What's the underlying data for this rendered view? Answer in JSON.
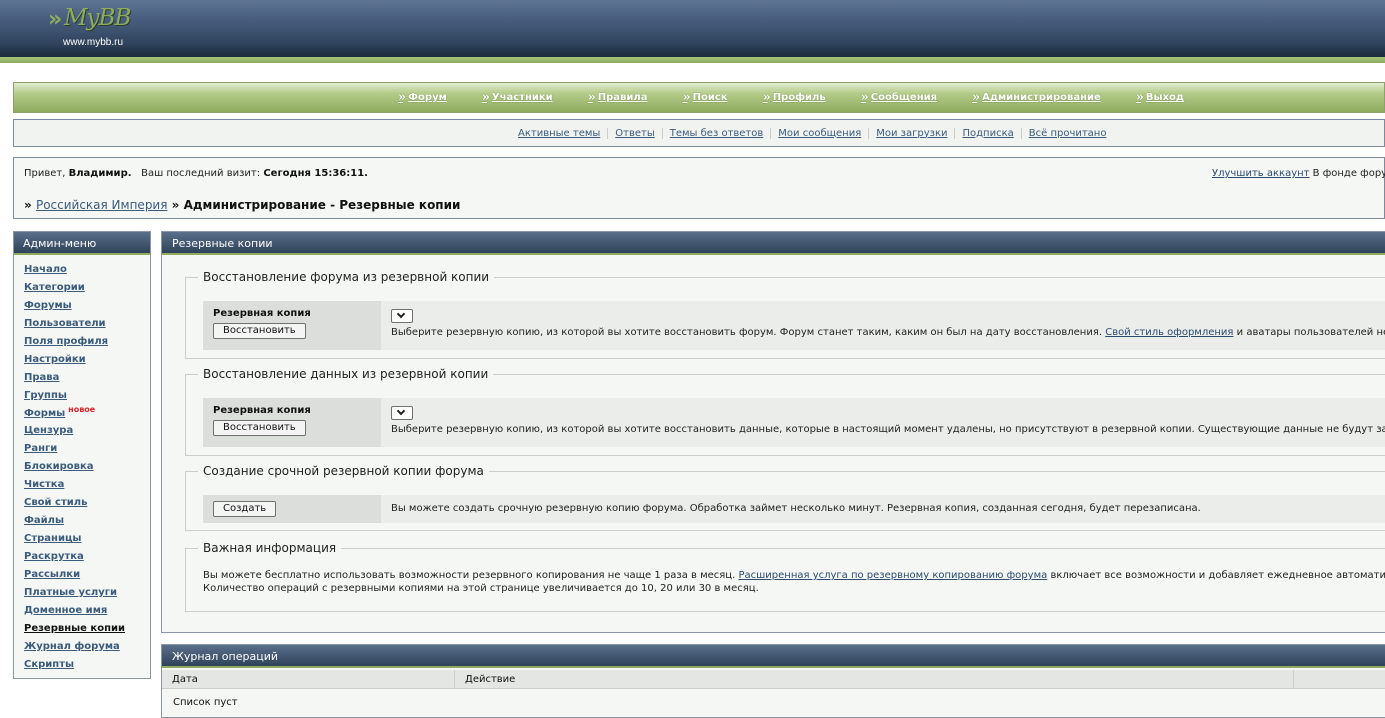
{
  "logo": {
    "mark": "MyBB",
    "arrows": "»",
    "url": "www.mybb.ru"
  },
  "mainnav": {
    "items": [
      {
        "label": "Форум"
      },
      {
        "label": "Участники"
      },
      {
        "label": "Правила"
      },
      {
        "label": "Поиск"
      },
      {
        "label": "Профиль"
      },
      {
        "label": "Сообщения"
      },
      {
        "label": "Администрирование"
      },
      {
        "label": "Выход"
      }
    ]
  },
  "subnav": {
    "items": [
      {
        "label": "Активные темы"
      },
      {
        "label": "Ответы"
      },
      {
        "label": "Темы без ответов"
      },
      {
        "label": "Мои сообщения"
      },
      {
        "label": "Мои загрузки"
      },
      {
        "label": "Подписка"
      },
      {
        "label": "Всё прочитано"
      }
    ]
  },
  "welcome": {
    "greeting_prefix": "Привет,",
    "user": "Владимир.",
    "last_visit_label": "Ваш последний визит:",
    "last_visit_value": "Сегодня 15:36:11.",
    "upgrade_link": "Улучшить аккаунт",
    "fund_text": "В фонде фору"
  },
  "breadcrumb": {
    "sep": "»",
    "root_link": "Российская Империя",
    "current": "» Администрирование - Резервные копии"
  },
  "sidebar": {
    "title": "Админ-меню",
    "new_badge": "новое",
    "items": [
      {
        "label": "Начало"
      },
      {
        "label": "Категории"
      },
      {
        "label": "Форумы"
      },
      {
        "label": "Пользователи"
      },
      {
        "label": "Поля профиля"
      },
      {
        "label": "Настройки"
      },
      {
        "label": "Права"
      },
      {
        "label": "Группы"
      },
      {
        "label": "Формы"
      },
      {
        "label": "Цензура"
      },
      {
        "label": "Ранги"
      },
      {
        "label": "Блокировка"
      },
      {
        "label": "Чистка"
      },
      {
        "label": "Свой стиль"
      },
      {
        "label": "Файлы"
      },
      {
        "label": "Страницы"
      },
      {
        "label": "Раскрутка"
      },
      {
        "label": "Рассылки"
      },
      {
        "label": "Платные услуги"
      },
      {
        "label": "Доменное имя"
      },
      {
        "label": "Резервные копии"
      },
      {
        "label": "Журнал форума"
      },
      {
        "label": "Скрипты"
      }
    ]
  },
  "content": {
    "title": "Резервные копии",
    "restore_forum": {
      "legend": "Восстановление форума из резервной копии",
      "label": "Резервная копия",
      "button": "Восстановить",
      "select_value": "",
      "desc_before": "Выберите резервную копию, из которой вы хотите восстановить форум. Форум станет таким, каким он был на дату восстановления.",
      "desc_link": "Свой стиль оформления",
      "desc_after": "и аватары пользователей не изме"
    },
    "restore_data": {
      "legend": "Восстановление данных из резервной копии",
      "label": "Резервная копия",
      "button": "Восстановить",
      "select_value": "",
      "desc": "Выберите резервную копию, из которой вы хотите восстановить данные, которые в настоящий момент удалены, но присутствуют в резервной копии. Существующие данные не будут затрону"
    },
    "create_backup": {
      "legend": "Создание срочной резервной копии форума",
      "button": "Создать",
      "desc": "Вы можете создать срочную резервную копию форума. Обработка займет несколько минут. Резервная копия, созданная сегодня, будет перезаписана."
    },
    "info": {
      "legend": "Важная информация",
      "line1_before": "Вы можете бесплатно использовать возможности резервного копирования не чаще 1 раза в месяц.",
      "line1_link": "Расширенная услуга по резервному копированию форума",
      "line1_after": "включает все возможности и добавляет ежедневное автоматическое",
      "line2": "Количество операций с резервными копиями на этой странице увеличивается до 10, 20 или 30 в месяц."
    }
  },
  "journal": {
    "title": "Журнал операций",
    "columns": [
      "Дата",
      "Действие"
    ],
    "empty_text": "Список пуст"
  },
  "colors": {
    "header_dark": "#2f425a",
    "nav_green": "#8eab5e",
    "link": "#3b5b7c",
    "new_badge": "#e0202a"
  }
}
